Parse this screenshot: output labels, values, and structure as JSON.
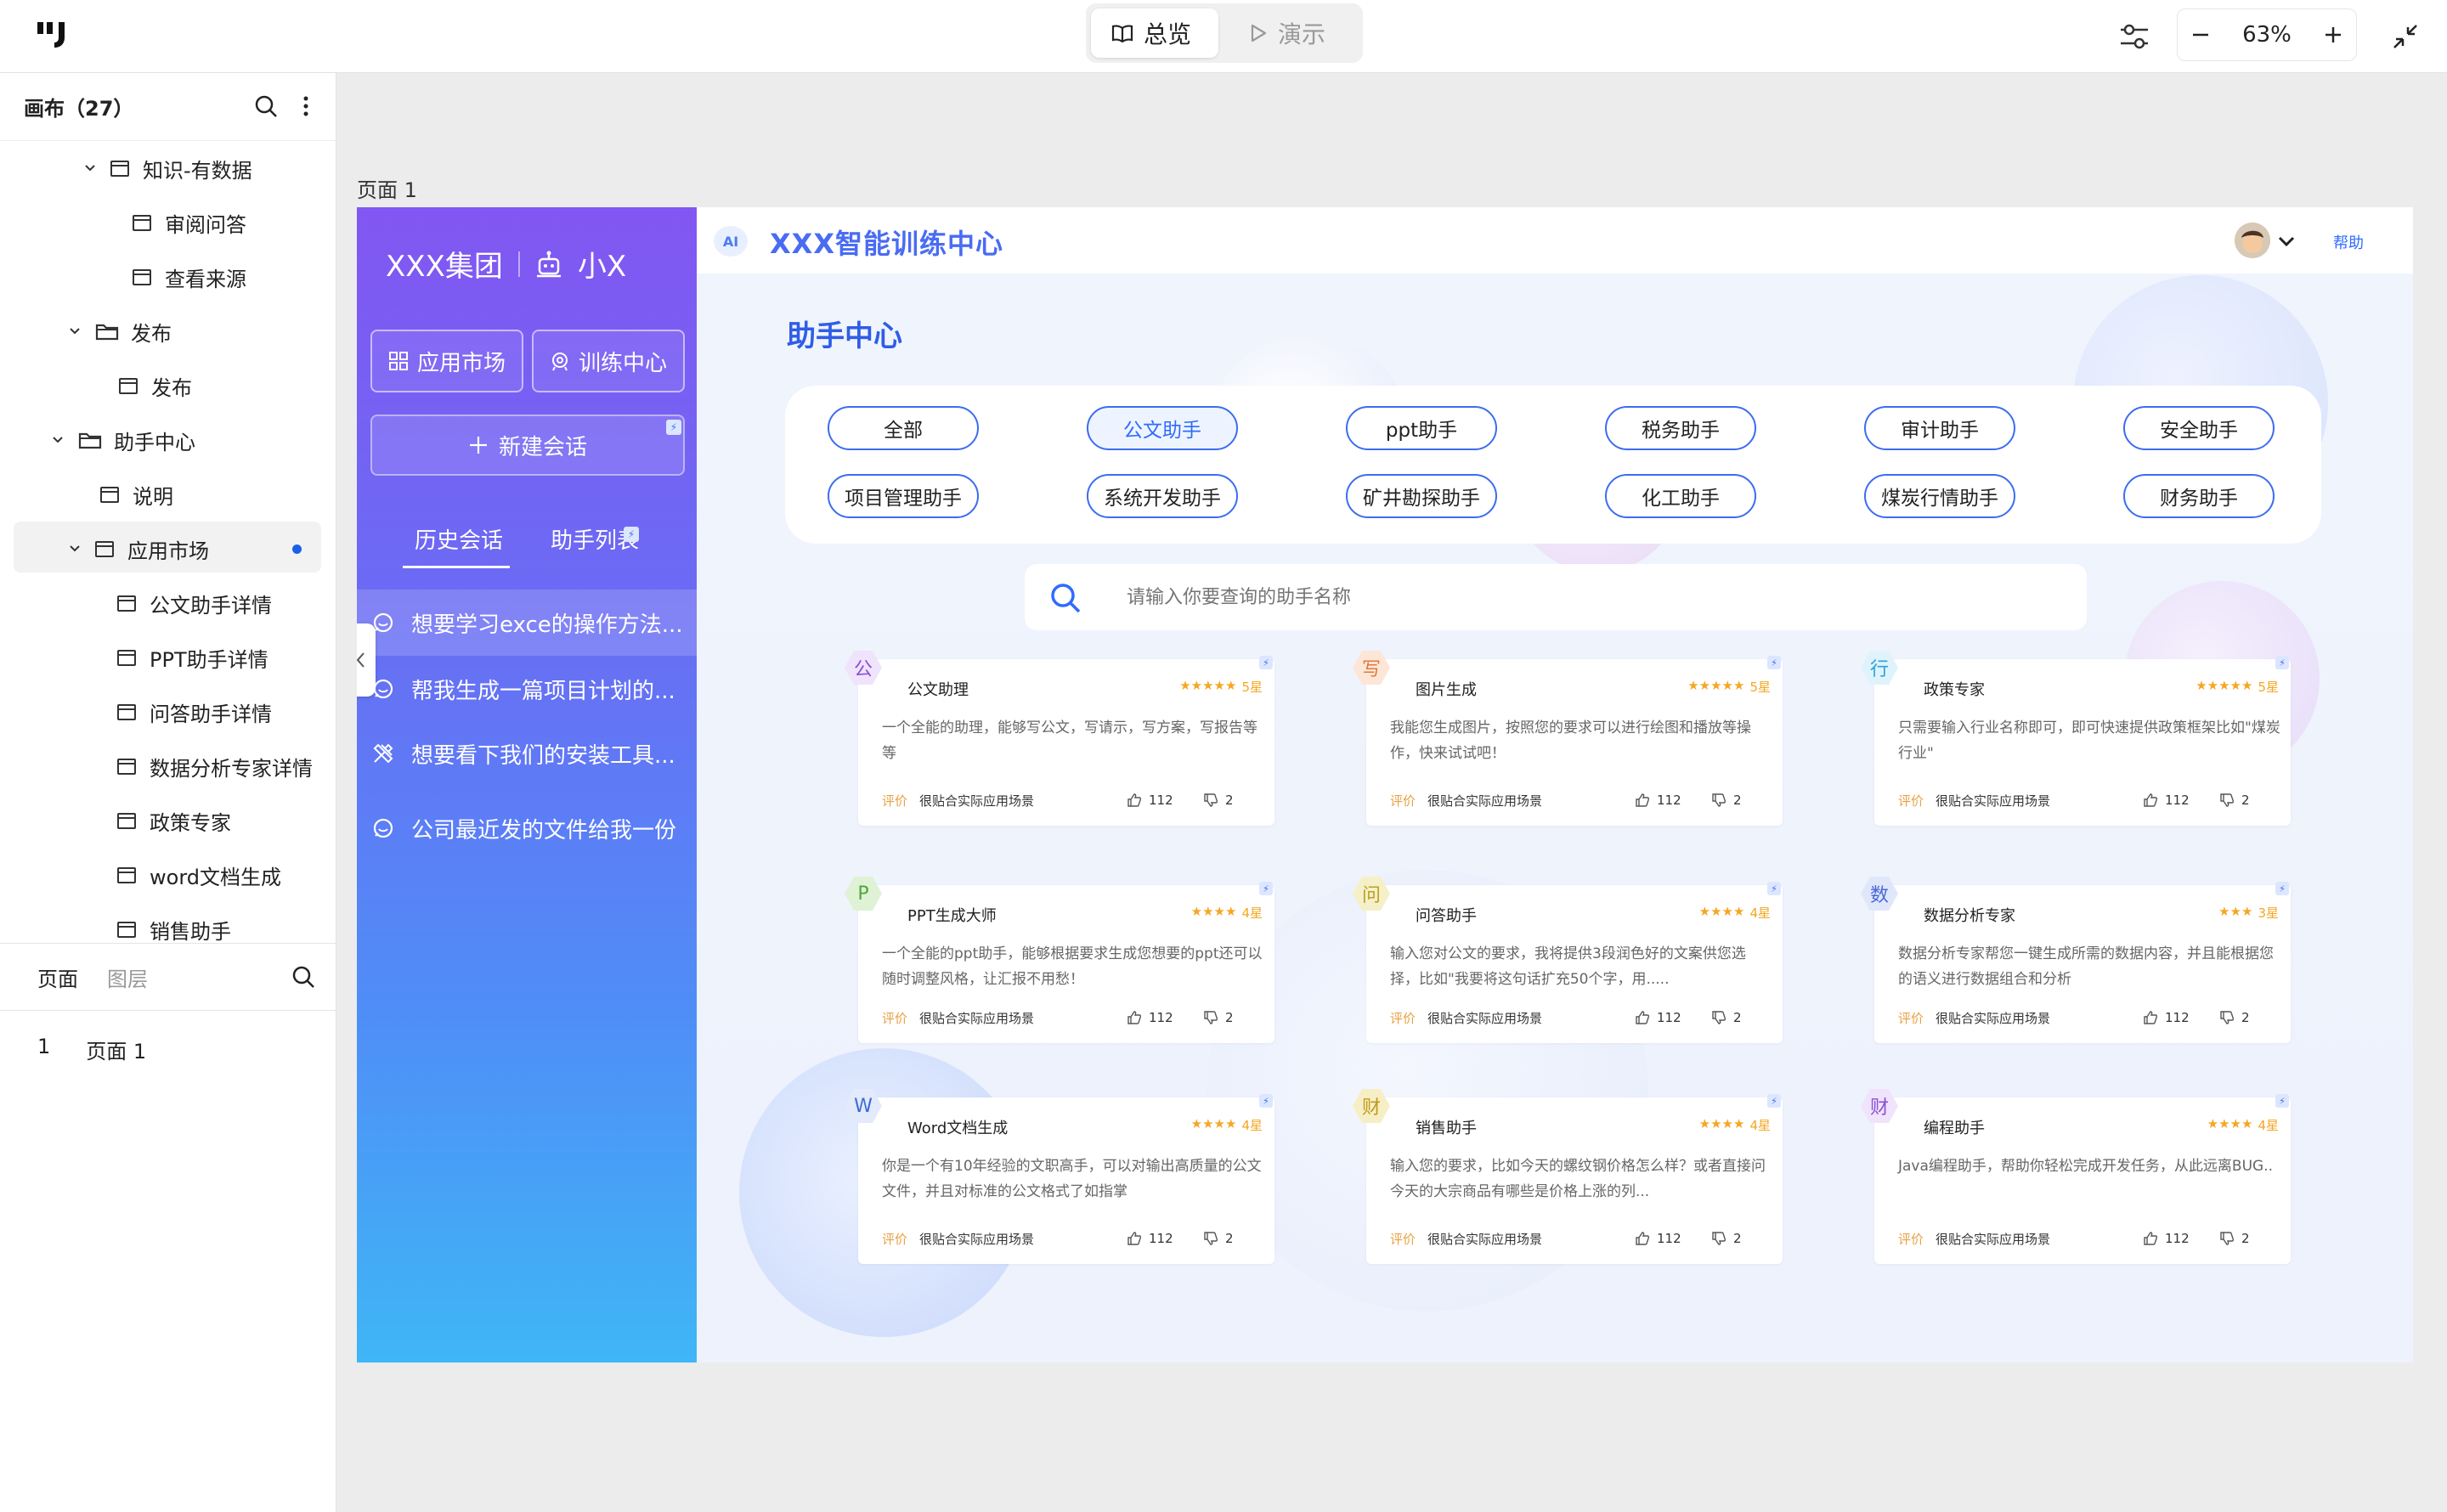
{
  "toolbar": {
    "mode_overview": "总览",
    "mode_present": "演示",
    "zoom": "63%"
  },
  "left_panel": {
    "canvas_title": "画布（27）",
    "tree": [
      {
        "label": "知识-有数据",
        "kind": "frame",
        "expanded": true
      },
      {
        "label": "审阅问答",
        "kind": "page"
      },
      {
        "label": "查看来源",
        "kind": "page"
      },
      {
        "label": "发布",
        "kind": "folder",
        "expanded": true
      },
      {
        "label": "发布",
        "kind": "page"
      },
      {
        "label": "助手中心",
        "kind": "folder",
        "expanded": true
      },
      {
        "label": "说明",
        "kind": "page"
      },
      {
        "label": "应用市场",
        "kind": "frame",
        "expanded": true,
        "selected": true
      },
      {
        "label": "公文助手详情",
        "kind": "page"
      },
      {
        "label": "PPT助手详情",
        "kind": "page"
      },
      {
        "label": "问答助手详情",
        "kind": "page"
      },
      {
        "label": "数据分析专家详情",
        "kind": "page"
      },
      {
        "label": "政策专家",
        "kind": "page"
      },
      {
        "label": "word文档生成",
        "kind": "page"
      },
      {
        "label": "销售助手",
        "kind": "page"
      }
    ],
    "tab_pages": "页面",
    "tab_layers": "图层",
    "pages": [
      {
        "index": "1",
        "label": "页面 1"
      }
    ]
  },
  "canvas": {
    "page_label": "页面 1"
  },
  "app": {
    "brand_group": "XXX集团",
    "brand_assistant": "小X",
    "btn_market": "应用市场",
    "btn_training": "训练中心",
    "new_chat": "新建会话",
    "tab_history": "历史会话",
    "tab_assistants": "助手列表",
    "history": [
      "想要学习exce的操作方法...",
      "帮我生成一篇项目计划的...",
      "想要看下我们的安装工具...",
      "公司最近发的文件给我一份"
    ],
    "header_title": "XXX智能训练中心",
    "help": "帮助",
    "section_title": "助手中心",
    "categories": [
      "全部",
      "公文助手",
      "ppt助手",
      "税务助手",
      "审计助手",
      "安全助手",
      "项目管理助手",
      "系统开发助手",
      "矿井勘探助手",
      "化工助手",
      "煤炭行情助手",
      "财务助手"
    ],
    "selected_category": "公文助手",
    "search_placeholder": "请输入你要查询的助手名称",
    "cards": [
      {
        "glyph": "公",
        "name": "公文助理",
        "stars": "★★★★★",
        "rating": "5星",
        "desc": "一个全能的助理，能够写公文，写请示，写方案，写报告等等",
        "label": "评价",
        "tag": "很贴合实际应用场景",
        "likes": "112",
        "dislikes": "2",
        "hex_bg": "#efe4fb",
        "hex_fg": "#8b4fd6"
      },
      {
        "glyph": "写",
        "name": "图片生成",
        "stars": "★★★★★",
        "rating": "5星",
        "desc": "我能您生成图片，按照您的要求可以进行绘图和播放等操作，快来试试吧！",
        "label": "评价",
        "tag": "很贴合实际应用场景",
        "likes": "112",
        "dislikes": "2",
        "hex_bg": "#fde6d8",
        "hex_fg": "#e07a3c"
      },
      {
        "glyph": "行",
        "name": "政策专家",
        "stars": "★★★★★",
        "rating": "5星",
        "desc": "只需要输入行业名称即可，即可快速提供政策框架比如\"煤炭行业\"",
        "label": "评价",
        "tag": "很贴合实际应用场景",
        "likes": "112",
        "dislikes": "2",
        "hex_bg": "#dff3fb",
        "hex_fg": "#2ba3d8"
      },
      {
        "glyph": "P",
        "name": "PPT生成大师",
        "stars": "★★★★",
        "rating": "4星",
        "desc": "一个全能的ppt助手，能够根据要求生成您想要的ppt还可以随时调整风格，让汇报不用愁！",
        "label": "评价",
        "tag": "很贴合实际应用场景",
        "likes": "112",
        "dislikes": "2",
        "hex_bg": "#dff2d6",
        "hex_fg": "#4fa83a"
      },
      {
        "glyph": "问",
        "name": "问答助手",
        "stars": "★★★★",
        "rating": "4星",
        "desc": "输入您对公文的要求，我将提供3段润色好的文案供您选择，比如\"我要将这句话扩充50个字，用.....",
        "label": "评价",
        "tag": "很贴合实际应用场景",
        "likes": "112",
        "dislikes": "2",
        "hex_bg": "#f5f0c8",
        "hex_fg": "#b8a21e"
      },
      {
        "glyph": "数",
        "name": "数据分析专家",
        "stars": "★★★",
        "rating": "3星",
        "desc": "数据分析专家帮您一键生成所需的数据内容，并且能根据您的语义进行数据组合和分析",
        "label": "评价",
        "tag": "很贴合实际应用场景",
        "likes": "112",
        "dislikes": "2",
        "hex_bg": "#e1e7fb",
        "hex_fg": "#4a68d8"
      },
      {
        "glyph": "W",
        "name": "Word文档生成",
        "stars": "★★★★",
        "rating": "4星",
        "desc": "你是一个有10年经验的文职高手，可以对输出高质量的公文文件，并且对标准的公文格式了如指掌",
        "label": "评价",
        "tag": "很贴合实际应用场景",
        "likes": "112",
        "dislikes": "2",
        "hex_bg": "#e2eafb",
        "hex_fg": "#3d6ad6"
      },
      {
        "glyph": "财",
        "name": "销售助手",
        "stars": "★★★★",
        "rating": "4星",
        "desc": "输入您的要求，比如今天的螺纹钢价格怎么样？或者直接问今天的大宗商品有哪些是价格上涨的列...",
        "label": "评价",
        "tag": "很贴合实际应用场景",
        "likes": "112",
        "dislikes": "2",
        "hex_bg": "#f6efc6",
        "hex_fg": "#c19a1a"
      },
      {
        "glyph": "财",
        "name": "编程助手",
        "stars": "★★★★",
        "rating": "4星",
        "desc": "Java编程助手，帮助你轻松完成开发任务，从此远离BUG..",
        "label": "评价",
        "tag": "很贴合实际应用场景",
        "likes": "112",
        "dislikes": "2",
        "hex_bg": "#efe4fb",
        "hex_fg": "#8b4fd6"
      }
    ]
  }
}
